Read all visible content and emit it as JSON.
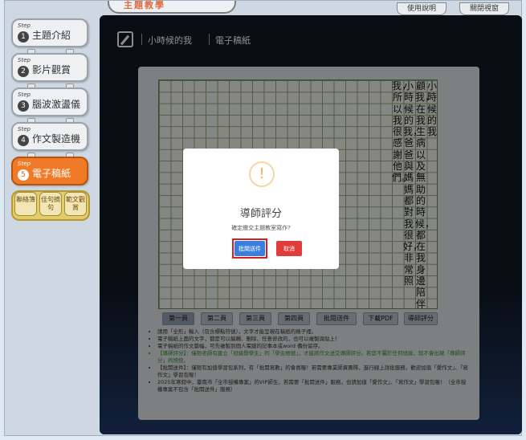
{
  "top": {
    "logo_text": "主題教學",
    "help_label": "使用說明",
    "close_label": "關閉視窗"
  },
  "sidebar": {
    "steps": [
      {
        "step": "Step",
        "num": "1",
        "label": "主題介紹"
      },
      {
        "step": "Step",
        "num": "2",
        "label": "影片觀賞"
      },
      {
        "step": "Step",
        "num": "3",
        "label": "腦波激盪儀"
      },
      {
        "step": "Step",
        "num": "4",
        "label": "作文製造機"
      },
      {
        "step": "Step",
        "num": "5",
        "label": "電子稿紙"
      }
    ],
    "mini": [
      "聯絡簿",
      "佳句摘句",
      "範文觀賞"
    ]
  },
  "header": {
    "crumb1": "小時候的我",
    "crumb2": "電子稿紙"
  },
  "essay": {
    "columns": [
      "小時候的我",
      "顧我，在我生病以及無助的時候，都在我身邊陪伴",
      "小時候的我，爸爸與媽媽都對我很好，非常照",
      "我，所以我很感謝他們。"
    ]
  },
  "page_buttons": [
    "第一頁",
    "第二頁",
    "第三頁",
    "第四頁",
    "批閱送件",
    "下載PDF",
    "導師評分"
  ],
  "notes": [
    "請用「全形」輸入（包含標點符號），文字才能呈現在稿紙的格子裡。",
    "電子稿紙上面的文字，都是可以編輯、刪除、任意修改的，也可以複製與貼上！",
    "電子稿紙的作文篇幅，可先複製到個人電腦的記事本或word 備份留存。",
    "【導師評分】：僅限老師有建立「班級暨學生」的「學生帳號」，才能將作文送交導師評分。若您不屬於任何班級，就不會出現「導師評分」的按鈕。",
    "【批閱送件】：僅限有加值學習包系列，有「批閱寫數」的會員喔！若需要專業師資團隊，進行線上詳批服務，歡迎加值「愛作文」、「寫作文」學習包喔！",
    "2025年寒假中，臺南市「全市授權專案」的VIP師生，若需要「批閱送件」服務，也請加值「愛作文」、「寫作文」學習包喔！（全市授權專案不包含「批閱送件」服務）"
  ],
  "modal": {
    "icon": "!",
    "title": "導師評分",
    "message": "確定繳交主題教室寫作?",
    "confirm_label": "批閱送件",
    "cancel_label": "取消"
  }
}
